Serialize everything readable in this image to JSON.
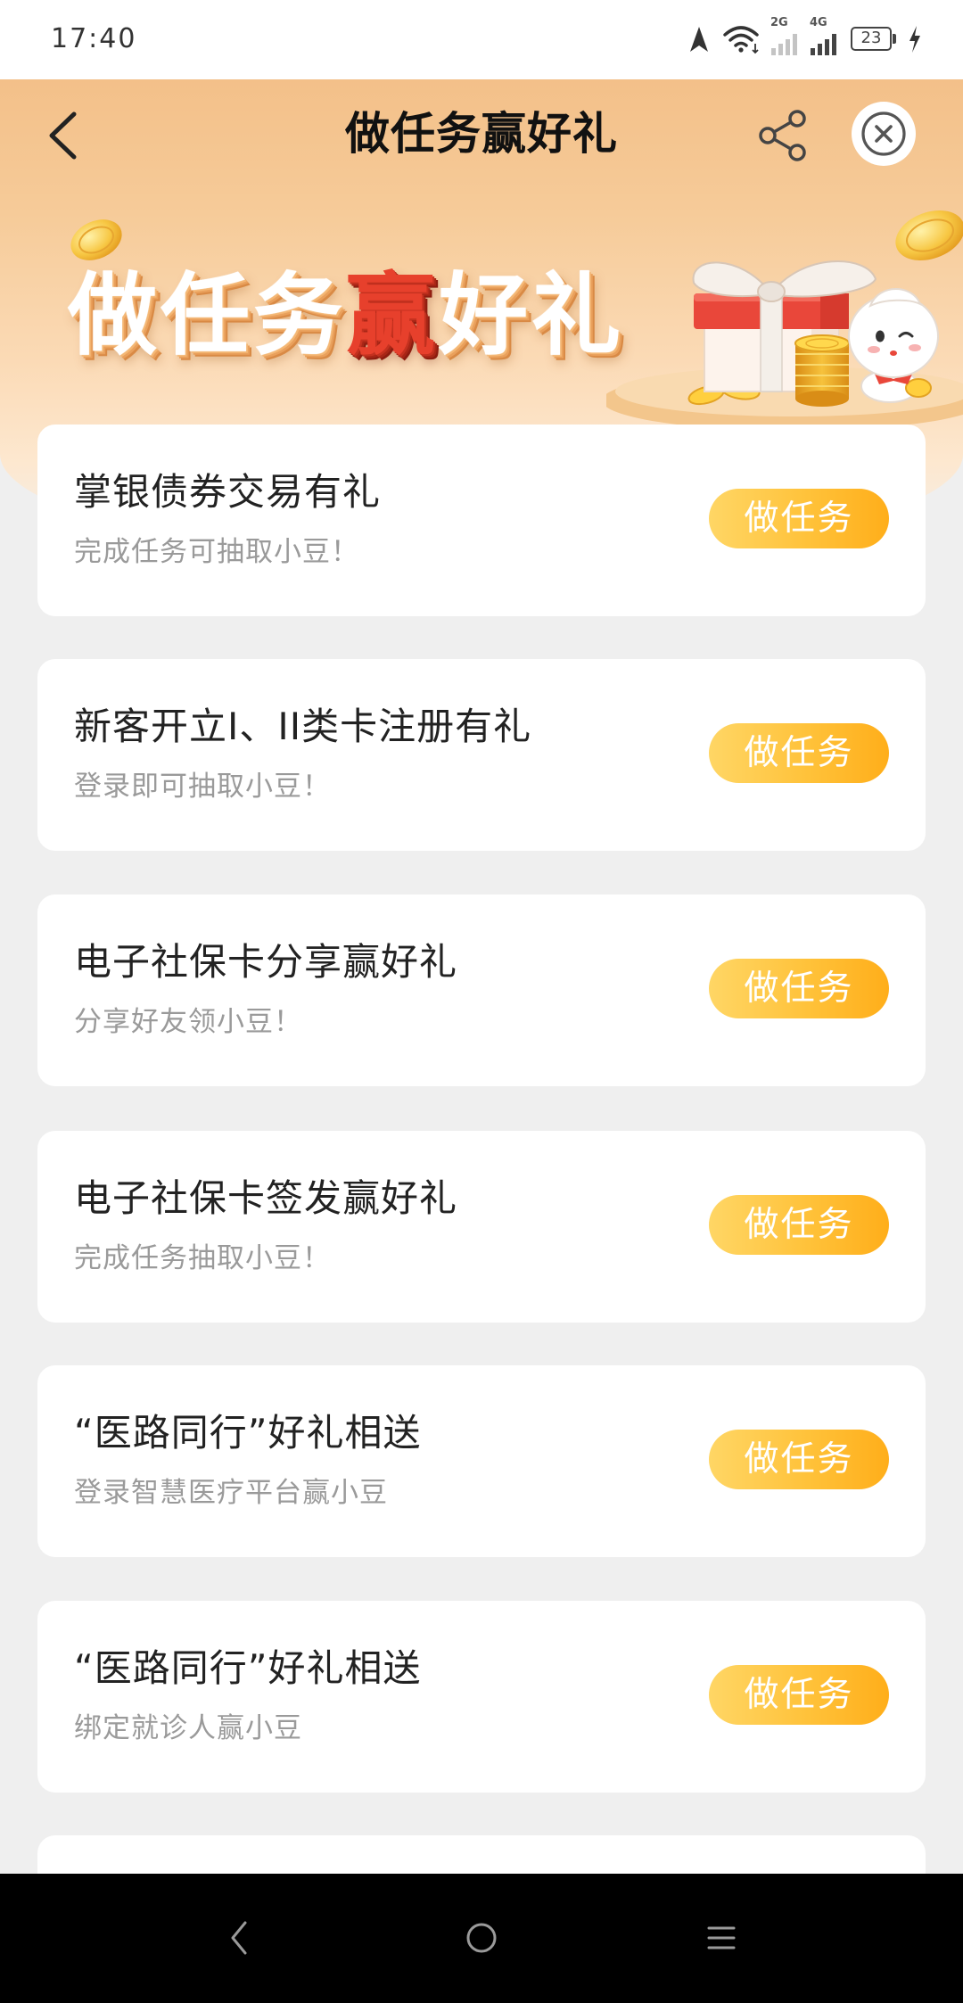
{
  "status_bar": {
    "time": "17:40",
    "network_1_label": "2G",
    "network_2_label": "4G",
    "battery_level": "23",
    "icons": [
      "location-arrow-icon",
      "wifi-icon",
      "signal-2g-icon",
      "signal-4g-icon",
      "battery-icon",
      "charging-icon"
    ]
  },
  "header": {
    "title": "做任务赢好礼",
    "icons": [
      "chevron-left-icon",
      "share-icon",
      "close-circle-icon"
    ]
  },
  "banner": {
    "headline_before": "做任务",
    "headline_highlight": "赢",
    "headline_after": "好礼"
  },
  "tasks": [
    {
      "title": "掌银债券交易有礼",
      "subtitle": "完成任务可抽取小豆！",
      "button_label": "做任务"
    },
    {
      "title": "新客开立I、II类卡注册有礼",
      "subtitle": "登录即可抽取小豆！",
      "button_label": "做任务"
    },
    {
      "title": "电子社保卡分享赢好礼",
      "subtitle": "分享好友领小豆！",
      "button_label": "做任务"
    },
    {
      "title": "电子社保卡签发赢好礼",
      "subtitle": "完成任务抽取小豆！",
      "button_label": "做任务"
    },
    {
      "title": "“医路同行”好礼相送",
      "subtitle": "登录智慧医疗平台赢小豆",
      "button_label": "做任务"
    },
    {
      "title": "“医路同行”好礼相送",
      "subtitle": "绑定就诊人赢小豆",
      "button_label": "做任务"
    }
  ],
  "navigation_bar": {
    "icons": [
      "back-icon",
      "home-icon",
      "menu-icon"
    ]
  },
  "colors": {
    "background": "#efefef",
    "header": "#f3c089",
    "button_gradient_start": "#ffd665",
    "button_gradient_end": "#ffae1a",
    "headline_highlight": "#e7402c",
    "card": "#ffffff",
    "title_text": "#222222",
    "subtitle_text": "#9a9a9a",
    "navigation_bar": "#000000"
  }
}
